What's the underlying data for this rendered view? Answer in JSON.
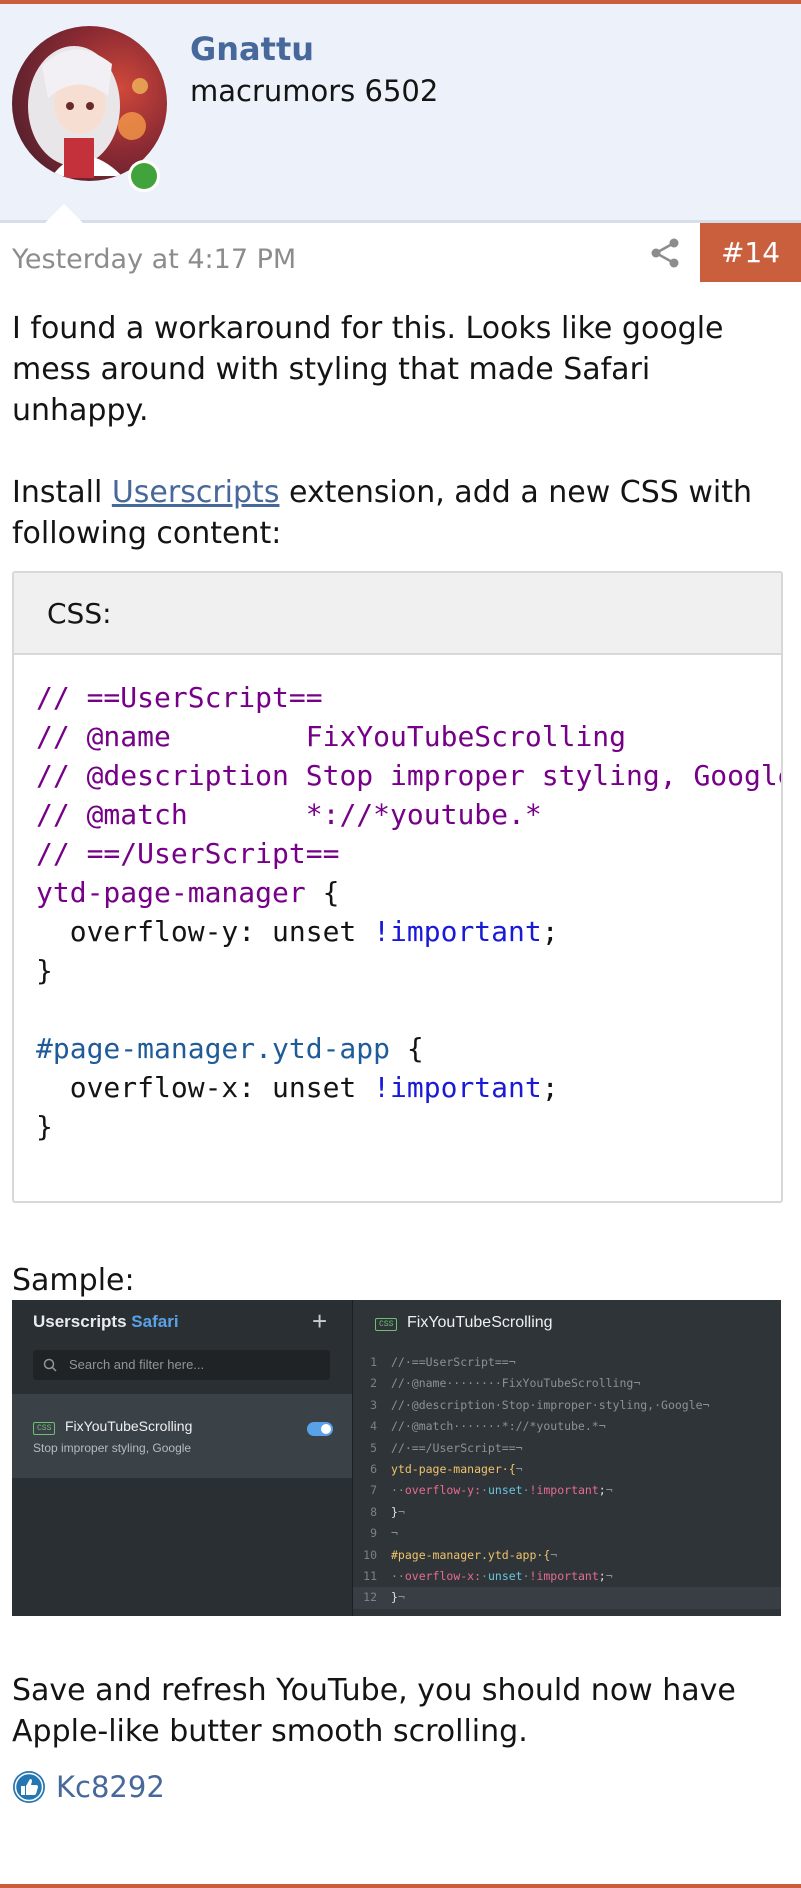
{
  "user": {
    "name": "Gnattu",
    "title": "macrumors 6502",
    "status_icon": "online-status-icon"
  },
  "post": {
    "date": "Yesterday at 4:17 PM",
    "number": "#14",
    "share_icon": "share-icon"
  },
  "message": {
    "paragraph1": "I found a workaround for this. Looks like google mess around with styling that made Safari unhappy.",
    "install_prefix": "Install ",
    "install_link": "Userscripts",
    "install_suffix": " extension, add a new CSS with following content:",
    "sample_label": "Sample:",
    "closing": "Save and refresh YouTube, you should now have Apple-like butter smooth scrolling."
  },
  "code": {
    "language_label": "CSS:",
    "lines": [
      {
        "text": "// ==UserScript=="
      },
      {
        "prefix": "// ",
        "key": "@name        FixYouTubeScrolling"
      },
      {
        "prefix": "// ",
        "key": "@description Stop improper styling, Google"
      },
      {
        "prefix": "// ",
        "key": "@match       *://*youtube.*"
      },
      {
        "prefix": "// ",
        "key": "==/UserScript=="
      },
      {
        "selector": "ytd-page-manager",
        "brace": " {"
      },
      {
        "prop": "  overflow-y: unset ",
        "important": "!important",
        "end": ";"
      },
      {
        "text": "}"
      },
      {
        "text": ""
      },
      {
        "selector": "#page-manager.ytd-app",
        "brace": " {"
      },
      {
        "prop": "  overflow-x: unset ",
        "important": "!important",
        "end": ";"
      },
      {
        "text": "}"
      }
    ]
  },
  "screenshot": {
    "app_name": "Userscripts",
    "app_accent": "Safari",
    "add_label": "+",
    "search_placeholder": "Search and filter here...",
    "badge": "CSS",
    "item_name": "FixYouTubeScrolling",
    "item_description": "Stop improper styling, Google",
    "toggle_on": true,
    "editor_title": "FixYouTubeScrolling",
    "editor_lines": [
      {
        "n": "1",
        "parts": [
          {
            "c": "t-com",
            "t": "//·==UserScript==¬"
          }
        ]
      },
      {
        "n": "2",
        "parts": [
          {
            "c": "t-com",
            "t": "//·@name········FixYouTubeScrolling¬"
          }
        ]
      },
      {
        "n": "3",
        "parts": [
          {
            "c": "t-com",
            "t": "//·@description·Stop·improper·styling,·Google¬"
          }
        ]
      },
      {
        "n": "4",
        "parts": [
          {
            "c": "t-com",
            "t": "//·@match·······*://*youtube.*¬"
          }
        ]
      },
      {
        "n": "5",
        "parts": [
          {
            "c": "t-com",
            "t": "//·==/UserScript==¬"
          }
        ]
      },
      {
        "n": "6",
        "parts": [
          {
            "c": "t-sel",
            "t": "ytd-page-manager·{"
          },
          {
            "c": "t-com",
            "t": "¬"
          }
        ]
      },
      {
        "n": "7",
        "parts": [
          {
            "c": "t-com",
            "t": "··"
          },
          {
            "c": "t-prop",
            "t": "overflow-y:"
          },
          {
            "c": "t-com",
            "t": "·"
          },
          {
            "c": "t-val",
            "t": "unset"
          },
          {
            "c": "t-com",
            "t": "·"
          },
          {
            "c": "t-prop",
            "t": "!important"
          },
          {
            "c": "t-plain",
            "t": ";"
          },
          {
            "c": "t-com",
            "t": "¬"
          }
        ]
      },
      {
        "n": "8",
        "parts": [
          {
            "c": "t-plain",
            "t": "}"
          },
          {
            "c": "t-com",
            "t": "¬"
          }
        ]
      },
      {
        "n": "9",
        "parts": [
          {
            "c": "t-com",
            "t": "¬"
          }
        ]
      },
      {
        "n": "10",
        "parts": [
          {
            "c": "t-sel",
            "t": "#page-manager.ytd-app·{"
          },
          {
            "c": "t-com",
            "t": "¬"
          }
        ]
      },
      {
        "n": "11",
        "parts": [
          {
            "c": "t-com",
            "t": "··"
          },
          {
            "c": "t-prop",
            "t": "overflow-x:"
          },
          {
            "c": "t-com",
            "t": "·"
          },
          {
            "c": "t-val",
            "t": "unset"
          },
          {
            "c": "t-com",
            "t": "·"
          },
          {
            "c": "t-prop",
            "t": "!important"
          },
          {
            "c": "t-plain",
            "t": ";"
          },
          {
            "c": "t-com",
            "t": "¬"
          }
        ]
      },
      {
        "n": "12",
        "parts": [
          {
            "c": "t-plain",
            "t": "}"
          },
          {
            "c": "t-com",
            "t": "¬"
          }
        ]
      }
    ]
  },
  "reactions": {
    "icon": "like-icon",
    "users": "Kc8292"
  },
  "colors": {
    "accent": "#c95f3d",
    "link": "#47689a",
    "header_bg": "#edf2fa",
    "online": "#41a33c"
  }
}
